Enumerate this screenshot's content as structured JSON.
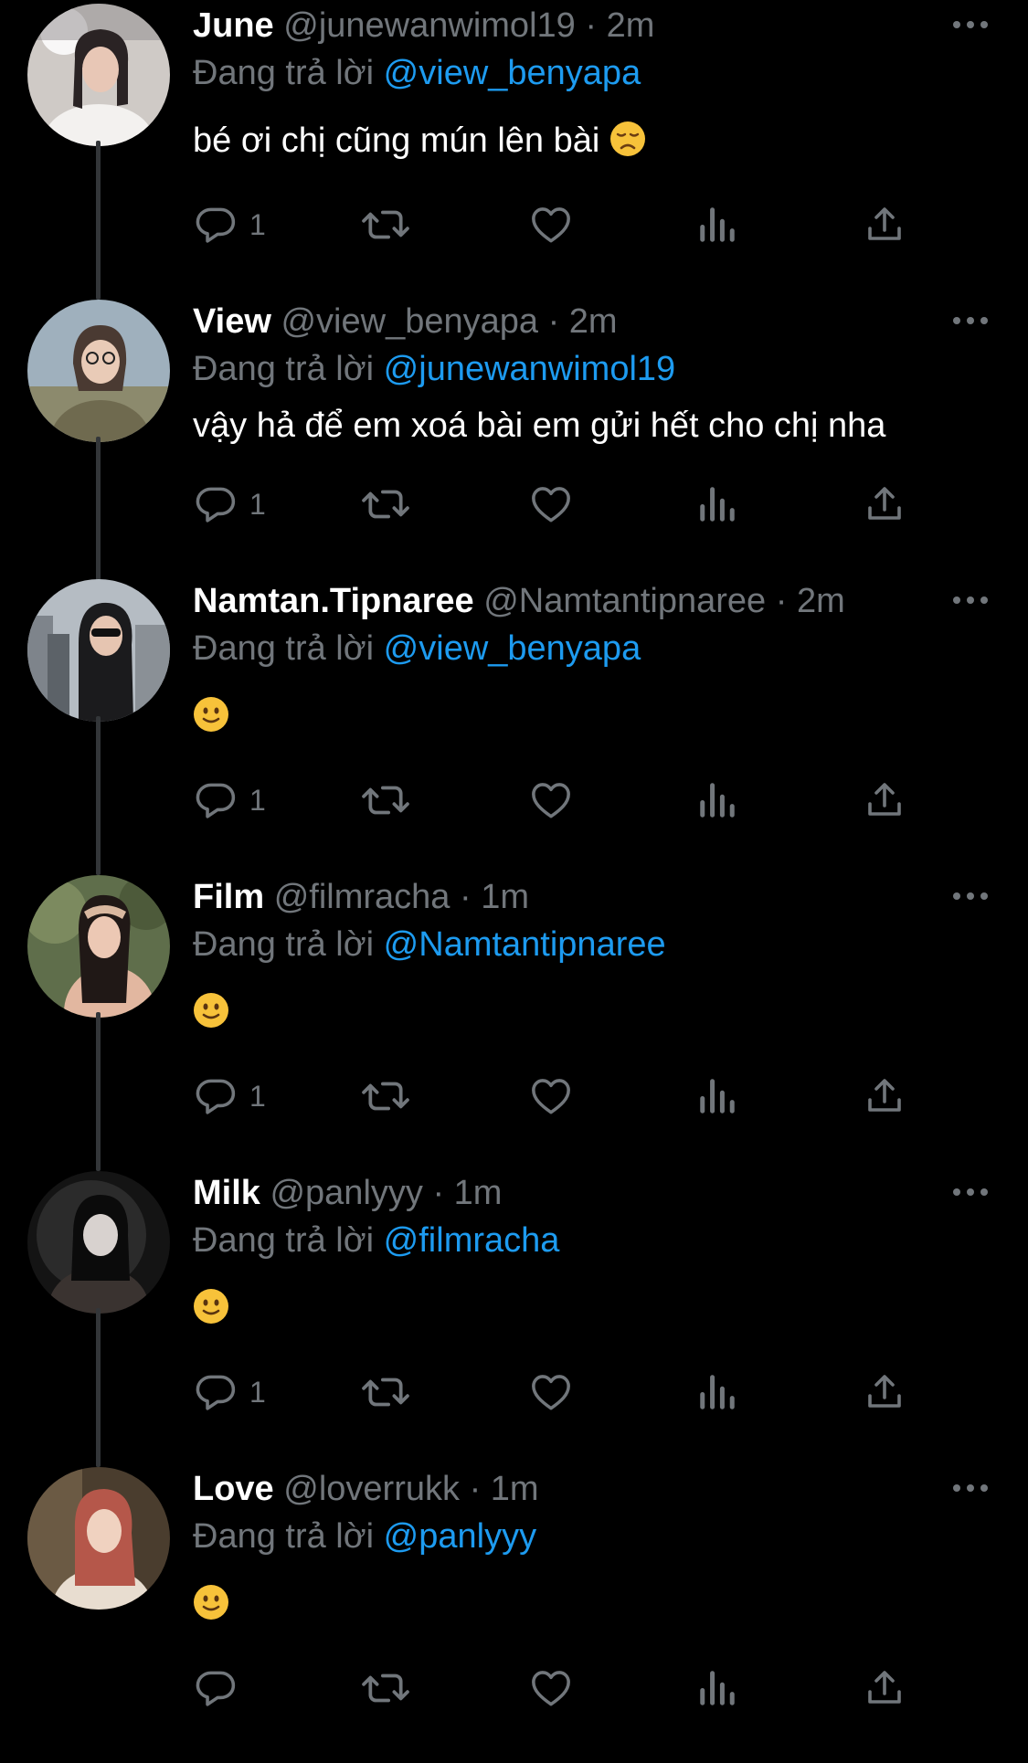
{
  "reply_prefix": "Đang trả lời",
  "colors": {
    "background": "#000000",
    "text": "#ffffff",
    "muted": "#71767b",
    "mention": "#1d9bf0",
    "thread_line": "#333639"
  },
  "icons": [
    "reply-icon",
    "retweet-icon",
    "like-icon",
    "views-icon",
    "share-icon",
    "more-icon"
  ],
  "tweets": [
    {
      "name": "June",
      "handle": "@junewanwimol19",
      "separator": "·",
      "time": "2m",
      "reply_to": "@view_benyapa",
      "text": "bé ơi chị cũng mún lên bài",
      "emoji": "disappointed-face",
      "reply_count": "1"
    },
    {
      "name": "View",
      "handle": "@view_benyapa",
      "separator": "·",
      "time": "2m",
      "reply_to": "@junewanwimol19",
      "text": "vậy hả để em xoá bài em gửi hết cho chị nha",
      "emoji": "",
      "reply_count": "1"
    },
    {
      "name": "Namtan.Tipnaree",
      "handle": "@Namtantipnaree",
      "separator": "·",
      "time": "2m",
      "reply_to": "@view_benyapa",
      "text": "",
      "emoji": "slightly-smiling-face",
      "reply_count": "1"
    },
    {
      "name": "Film",
      "handle": "@filmracha",
      "separator": "·",
      "time": "1m",
      "reply_to": "@Namtantipnaree",
      "text": "",
      "emoji": "slightly-smiling-face",
      "reply_count": "1"
    },
    {
      "name": "Milk",
      "handle": "@panlyyy",
      "separator": "·",
      "time": "1m",
      "reply_to": "@filmracha",
      "text": "",
      "emoji": "slightly-smiling-face",
      "reply_count": "1"
    },
    {
      "name": "Love",
      "handle": "@loverrukk",
      "separator": "·",
      "time": "1m",
      "reply_to": "@panlyyy",
      "text": "",
      "emoji": "slightly-smiling-face",
      "reply_count": ""
    }
  ]
}
